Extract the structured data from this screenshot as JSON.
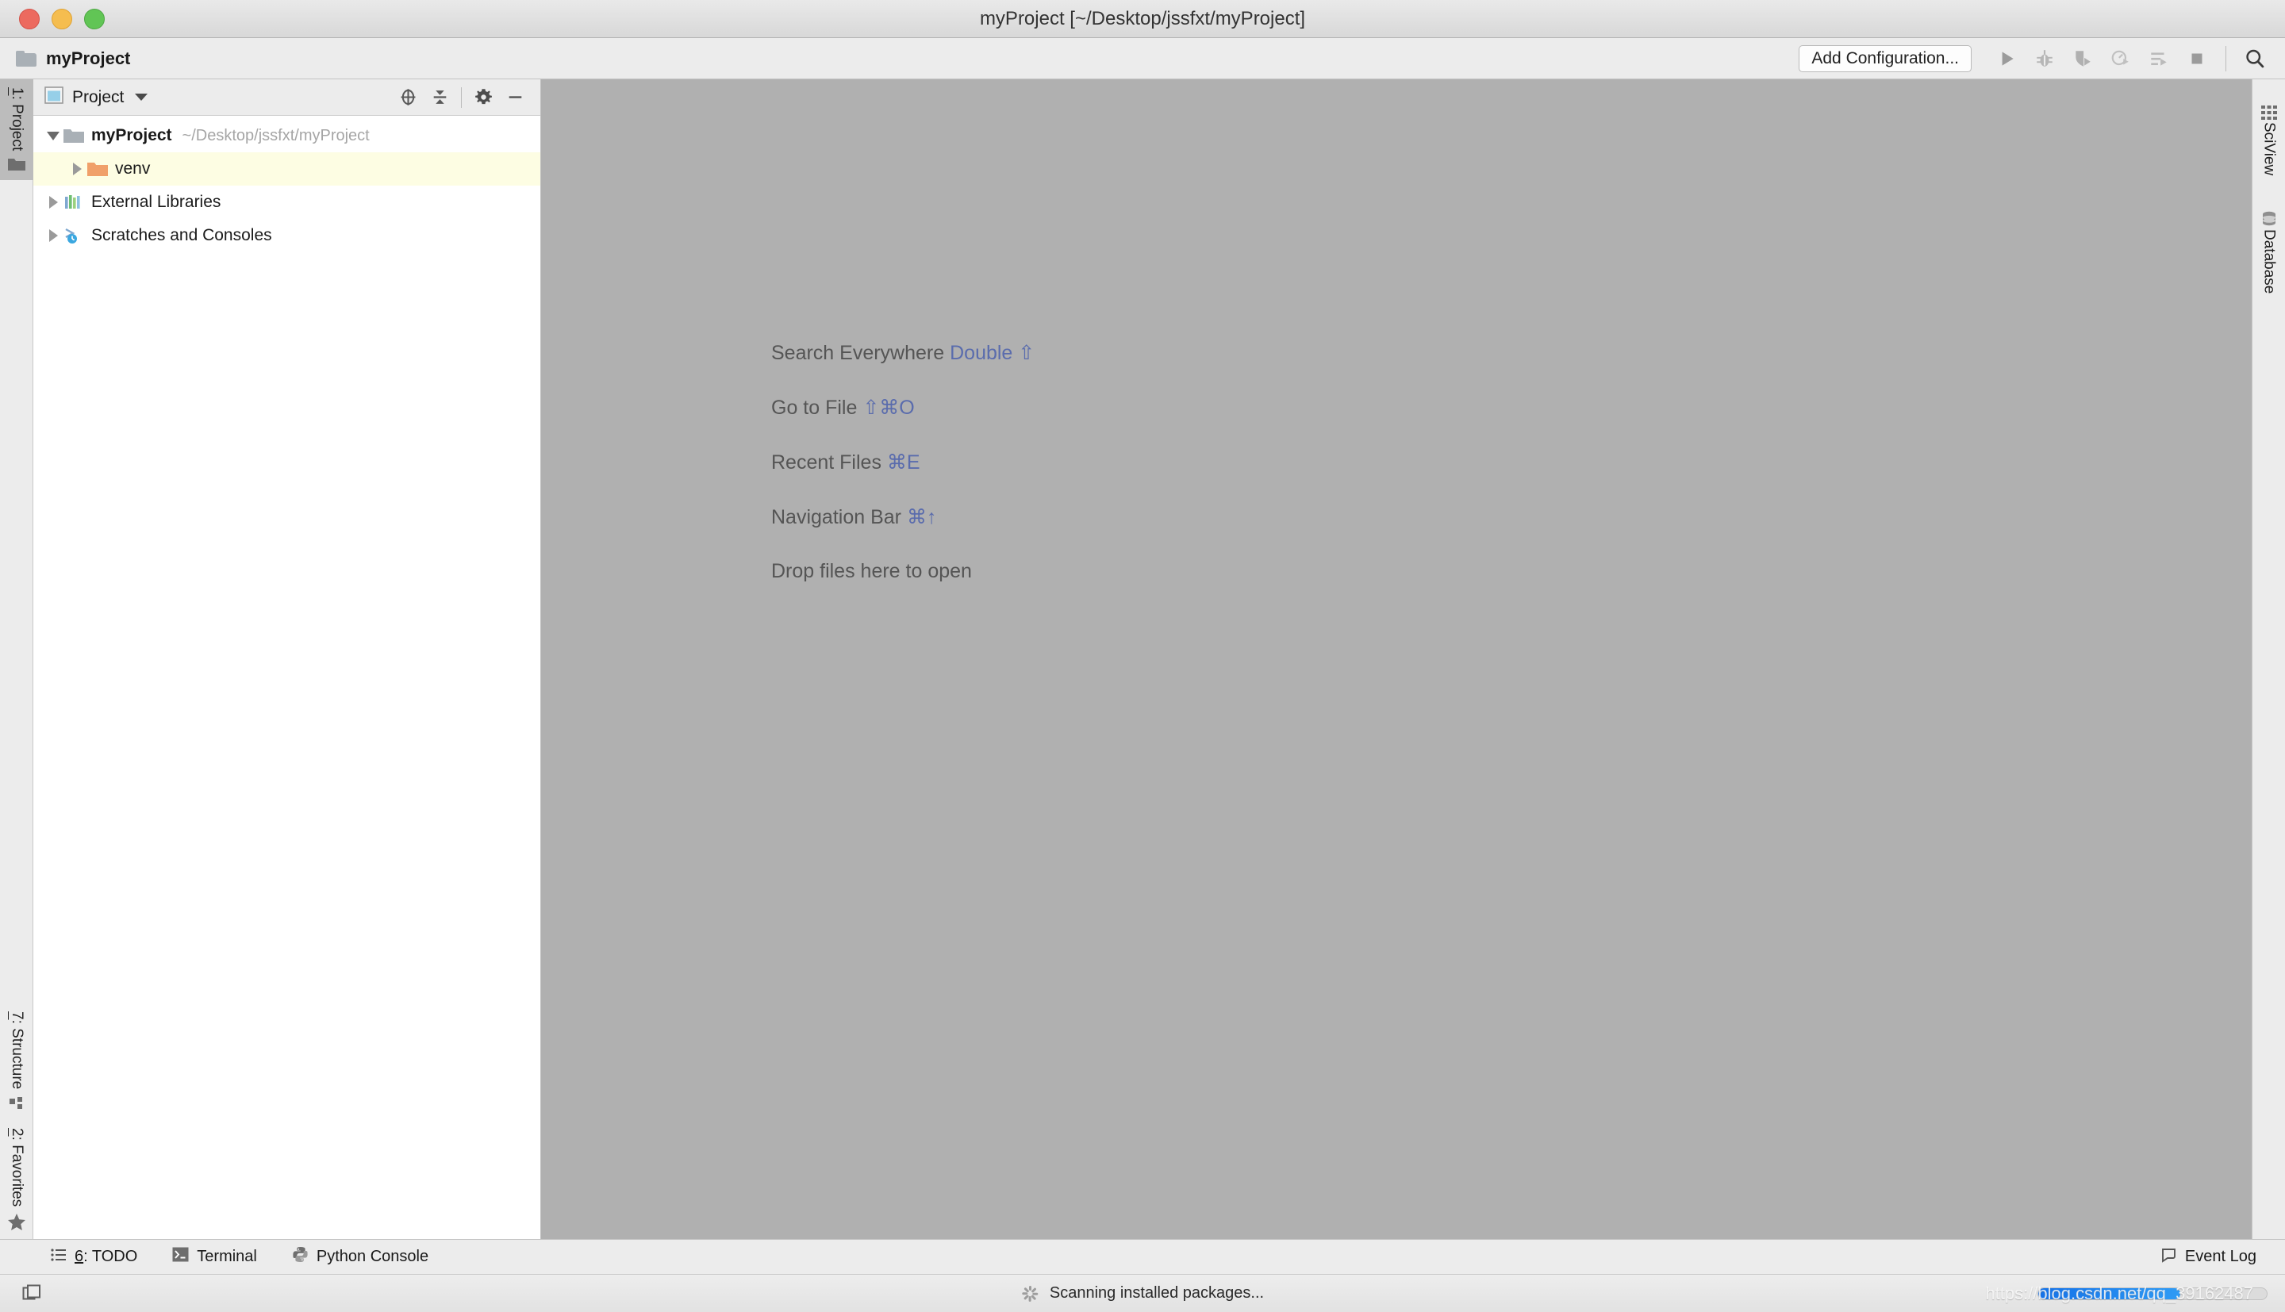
{
  "window": {
    "title": "myProject [~/Desktop/jssfxt/myProject]",
    "traffic": {
      "close": "close-button",
      "minimize": "minimize-button",
      "zoom": "zoom-button"
    }
  },
  "navbar": {
    "breadcrumb": "myProject",
    "breadcrumb_icon": "folder-icon",
    "add_configuration": "Add Configuration...",
    "buttons": [
      {
        "name": "run-button",
        "icon": "run-play-icon",
        "title": "Run"
      },
      {
        "name": "debug-button",
        "icon": "debug-bug-icon",
        "title": "Debug"
      },
      {
        "name": "run-with-coverage-button",
        "icon": "coverage-shield-icon",
        "title": "Run with Coverage"
      },
      {
        "name": "profile-button",
        "icon": "profile-clock-icon",
        "title": "Profile"
      },
      {
        "name": "run-with-params-button",
        "icon": "run-params-icon",
        "title": "Run with Parameters"
      },
      {
        "name": "stop-button",
        "icon": "stop-square-icon",
        "title": "Stop"
      },
      {
        "name": "search-everywhere-button",
        "icon": "search-magnifier-icon",
        "title": "Search Everywhere"
      }
    ]
  },
  "left_stripe": {
    "top": [
      {
        "label": "1: Project",
        "mnemonic": "1",
        "rest": ": Project",
        "icon": "folder-icon",
        "active": true
      }
    ],
    "bottom": [
      {
        "label": "7: Structure",
        "mnemonic": "7",
        "rest": ": Structure",
        "icon": "structure-icon",
        "active": false
      },
      {
        "label": "2: Favorites",
        "mnemonic": "2",
        "rest": ": Favorites",
        "icon": "star-icon",
        "active": false
      }
    ]
  },
  "right_stripe": {
    "items": [
      {
        "label": "SciView",
        "icon": "grid-icon"
      },
      {
        "label": "Database",
        "icon": "database-cylinder-icon"
      }
    ]
  },
  "project_panel": {
    "view_icon": "project-view-icon",
    "title": "Project",
    "dropdown_icon": "chevron-down-icon",
    "actions": [
      {
        "name": "select-opened-file-button",
        "icon": "locate-target-icon"
      },
      {
        "name": "collapse-all-button",
        "icon": "collapse-all-icon"
      },
      {
        "name": "settings-button",
        "icon": "gear-icon"
      },
      {
        "name": "hide-button",
        "icon": "minimize-dash-icon"
      }
    ],
    "tree": [
      {
        "label": "myProject",
        "path": "~/Desktop/jssfxt/myProject",
        "icon": "folder-icon",
        "icon_color": "#a9b0b6",
        "indent": 0,
        "expanded": true,
        "bold": true,
        "selected": false
      },
      {
        "label": "venv",
        "path": "",
        "icon": "folder-icon",
        "icon_color": "#f0a06a",
        "indent": 1,
        "expanded": false,
        "bold": false,
        "selected": true
      },
      {
        "label": "External Libraries",
        "path": "",
        "icon": "external-libraries-icon",
        "icon_color": "",
        "indent": 0,
        "expanded": false,
        "bold": false,
        "selected": false
      },
      {
        "label": "Scratches and Consoles",
        "path": "",
        "icon": "scratches-icon",
        "icon_color": "",
        "indent": 0,
        "expanded": false,
        "bold": false,
        "selected": false
      }
    ]
  },
  "editor": {
    "background_color": "#b0b0b0",
    "hints": [
      {
        "action": "Search Everywhere",
        "shortcut": "Double ⇧"
      },
      {
        "action": "Go to File",
        "shortcut": "⇧⌘O"
      },
      {
        "action": "Recent Files",
        "shortcut": "⌘E"
      },
      {
        "action": "Navigation Bar",
        "shortcut": "⌘↑"
      }
    ],
    "drop_message": "Drop files here to open"
  },
  "bottom_bar": {
    "items": [
      {
        "label": "6: TODO",
        "mnemonic": "6",
        "rest": ": TODO",
        "icon": "todo-list-icon"
      },
      {
        "label": "Terminal",
        "mnemonic": "",
        "rest": "Terminal",
        "icon": "terminal-icon"
      },
      {
        "label": "Python Console",
        "mnemonic": "",
        "rest": "Python Console",
        "icon": "python-icon"
      }
    ],
    "event_log": {
      "label": "Event Log",
      "icon": "event-log-balloon-icon"
    }
  },
  "status_bar": {
    "hide_windows_icon": "hide-tool-windows-icon",
    "message": "Scanning installed packages...",
    "spinner_icon": "loading-spinner-icon",
    "progress_percent": 62,
    "watermark": "https://blog.csdn.net/qq_39162487",
    "accent_color": "#1572e8"
  }
}
